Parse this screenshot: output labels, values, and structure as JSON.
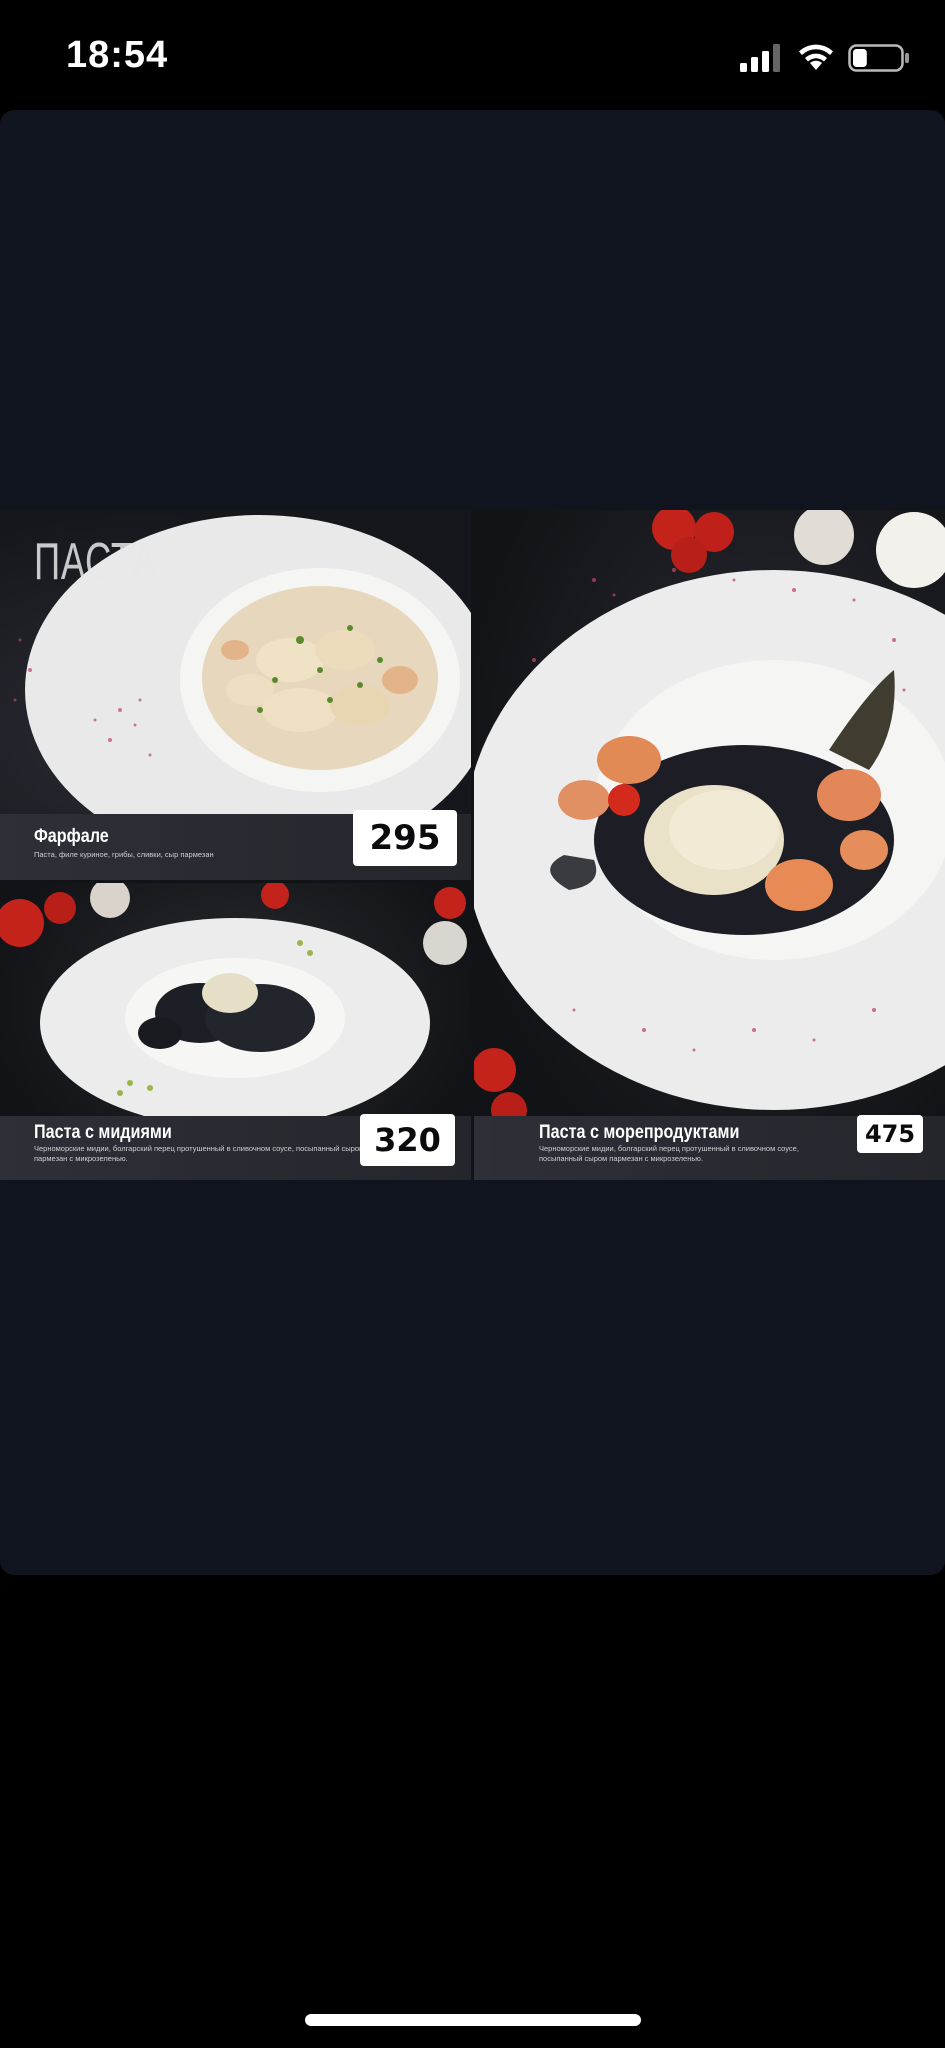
{
  "status_bar": {
    "time": "18:54",
    "signal_icon": "cellular-signal-icon",
    "wifi_icon": "wifi-icon",
    "battery_icon": "battery-icon",
    "battery_level": 0.3
  },
  "menu": {
    "section_title": "ПАСТА",
    "items": [
      {
        "name": "Фарфале",
        "description": "Паста, филе куриное, грибы, сливки, сыр пармезан",
        "price": "295"
      },
      {
        "name": "Паста с мидиями",
        "description": "Черноморские мидии, болгарский перец протушенный в сливочном соусе, посыпанный сыром пармезан с микрозеленью.",
        "price": "320"
      },
      {
        "name": "Паста с морепродуктами",
        "description": "Черноморские мидии, болгарский перец протушенный в сливочном соусе, посыпанный сыром пармезан с микрозеленью.",
        "price": "475"
      }
    ]
  },
  "colors": {
    "viewer_background": "#10141f",
    "price_tag": "#ffffff",
    "caption_bar": "#2e2f37"
  }
}
